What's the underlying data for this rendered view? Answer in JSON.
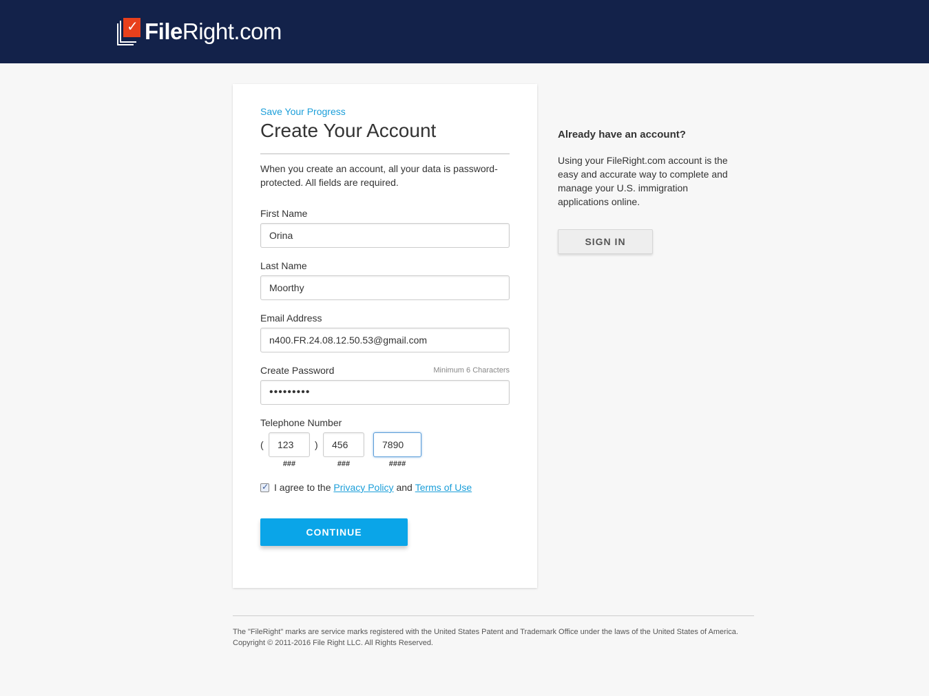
{
  "header": {
    "logo_bold": "File",
    "logo_bold2": "Right",
    "logo_light": ".com"
  },
  "form": {
    "eyebrow": "Save Your Progress",
    "title": "Create Your Account",
    "intro": "When you create an account, all your data is password-protected. All fields are required.",
    "first_name_label": "First Name",
    "first_name_value": "Orina",
    "last_name_label": "Last Name",
    "last_name_value": "Moorthy",
    "email_label": "Email Address",
    "email_value": "n400.FR.24.08.12.50.53@gmail.com",
    "password_label": "Create Password",
    "password_hint": "Minimum 6 Characters",
    "password_value": "•••••••••",
    "phone_label": "Telephone Number",
    "phone_open_paren": "(",
    "phone_close_paren": ")",
    "phone_area": "123",
    "phone_prefix": "456",
    "phone_line": "7890",
    "phone_area_hint": "###",
    "phone_prefix_hint": "###",
    "phone_line_hint": "####",
    "agree_prefix": "I agree to the",
    "privacy_link": "Privacy Policy",
    "agree_and": "and",
    "terms_link": "Terms of Use",
    "agree_checked": true,
    "continue_label": "CONTINUE"
  },
  "sidebar": {
    "heading": "Already have an account?",
    "text": "Using your FileRight.com account is the easy and accurate way to complete and manage your U.S. immigration applications online.",
    "signin_label": "SIGN IN"
  },
  "footer": {
    "line1": "The \"FileRight\" marks are service marks registered with the United States Patent and Trademark Office under the laws of the United States of America.",
    "line2": "Copyright © 2011-2016 File Right LLC. All Rights Reserved."
  },
  "colors": {
    "header_bg": "#13224a",
    "accent": "#1a9ed9",
    "continue_bg": "#0aa5e8",
    "logo_red": "#e8401c"
  }
}
